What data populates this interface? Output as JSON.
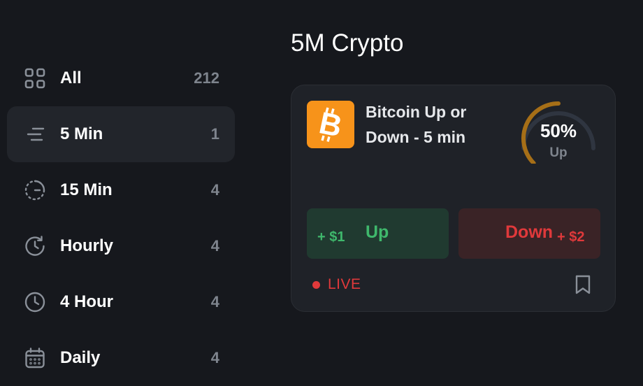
{
  "sidebar": {
    "items": [
      {
        "label": "All",
        "count": "212",
        "icon": "grid-icon"
      },
      {
        "label": "5 Min",
        "count": "1",
        "icon": "lines-icon",
        "active": true
      },
      {
        "label": "15 Min",
        "count": "4",
        "icon": "dashed-timer-icon"
      },
      {
        "label": "Hourly",
        "count": "4",
        "icon": "clock-rotate-icon"
      },
      {
        "label": "4 Hour",
        "count": "4",
        "icon": "clock-icon"
      },
      {
        "label": "Daily",
        "count": "4",
        "icon": "calendar-icon"
      }
    ]
  },
  "page": {
    "title": "5M Crypto"
  },
  "market": {
    "title": "Bitcoin Up or Down - 5 min",
    "coin_icon": "bitcoin-icon",
    "gauge": {
      "value": "50%",
      "label": "Up",
      "fraction": 0.5,
      "fill_color": "#a66f17",
      "track_color": "#2f3540"
    },
    "up_button": {
      "label": "Up",
      "amount": "+ $1",
      "color": "#3fb86c"
    },
    "down_button": {
      "label": "Down",
      "amount": "+ $2",
      "color": "#e0393b"
    },
    "status": "LIVE",
    "bookmark_icon": "bookmark-icon"
  }
}
